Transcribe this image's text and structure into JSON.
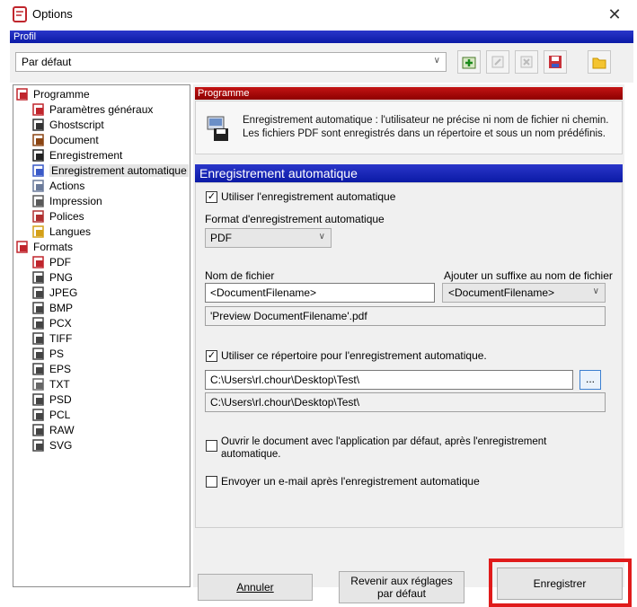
{
  "window": {
    "title": "Options",
    "close_glyph": "✕"
  },
  "profile": {
    "band_label": "Profil",
    "selected": "Par défaut"
  },
  "tree": {
    "items": [
      {
        "label": "Programme",
        "icon": "app-icon"
      },
      {
        "label": "Paramètres généraux",
        "icon": "app-icon"
      },
      {
        "label": "Ghostscript",
        "icon": "ghostscript-icon"
      },
      {
        "label": "Document",
        "icon": "document-icon"
      },
      {
        "label": "Enregistrement",
        "icon": "save-icon"
      },
      {
        "label": "Enregistrement automatique",
        "icon": "autosave-icon"
      },
      {
        "label": "Actions",
        "icon": "actions-icon"
      },
      {
        "label": "Impression",
        "icon": "printer-icon"
      },
      {
        "label": "Polices",
        "icon": "fonts-icon"
      },
      {
        "label": "Langues",
        "icon": "languages-icon"
      },
      {
        "label": "Formats",
        "icon": "app-icon"
      },
      {
        "label": "PDF",
        "icon": "pdf-icon"
      },
      {
        "label": "PNG",
        "icon": "image-file-icon"
      },
      {
        "label": "JPEG",
        "icon": "image-file-icon"
      },
      {
        "label": "BMP",
        "icon": "image-file-icon"
      },
      {
        "label": "PCX",
        "icon": "image-file-icon"
      },
      {
        "label": "TIFF",
        "icon": "image-file-icon"
      },
      {
        "label": "PS",
        "icon": "image-file-icon"
      },
      {
        "label": "EPS",
        "icon": "image-file-icon"
      },
      {
        "label": "TXT",
        "icon": "text-file-icon"
      },
      {
        "label": "PSD",
        "icon": "image-file-icon"
      },
      {
        "label": "PCL",
        "icon": "image-file-icon"
      },
      {
        "label": "RAW",
        "icon": "image-file-icon"
      },
      {
        "label": "SVG",
        "icon": "image-file-icon"
      }
    ]
  },
  "programme": {
    "band_label": "Programme",
    "info_line1": "Enregistrement automatique : l'utilisateur ne précise ni nom de fichier ni chemin.",
    "info_line2": "Les fichiers PDF sont enregistrés dans un répertoire et sous un nom prédéfinis."
  },
  "autosave": {
    "title": "Enregistrement automatique",
    "use_autosave_label": "Utiliser l'enregistrement automatique",
    "use_autosave_checked": true,
    "format_label": "Format d'enregistrement automatique",
    "format_value": "PDF",
    "filename_label": "Nom de fichier",
    "filename_value": "<DocumentFilename>",
    "suffix_label": "Ajouter un suffixe au nom de fichier",
    "suffix_value": "<DocumentFilename>",
    "filename_preview": "'Preview DocumentFilename'.pdf",
    "use_dir_label": "Utiliser ce répertoire pour l'enregistrement automatique.",
    "use_dir_checked": true,
    "dir_value": "C:\\Users\\rl.chour\\Desktop\\Test\\",
    "dir_preview": "C:\\Users\\rl.chour\\Desktop\\Test\\",
    "browse_label": "...",
    "open_doc_label_line1": "Ouvrir le document avec l'application par défaut, après l'enregistrement",
    "open_doc_label_line2": "automatique.",
    "open_doc_checked": false,
    "send_email_label": "Envoyer un e-mail après l'enregistrement automatique",
    "send_email_checked": false
  },
  "buttons": {
    "cancel": "Annuler",
    "reset_line1": "Revenir aux réglages",
    "reset_line2": "par défaut",
    "save": "Enregistrer"
  },
  "colors": {
    "blue_band": "#0b1aa6",
    "red_band": "#b00000",
    "highlight": "#e01b1b"
  }
}
